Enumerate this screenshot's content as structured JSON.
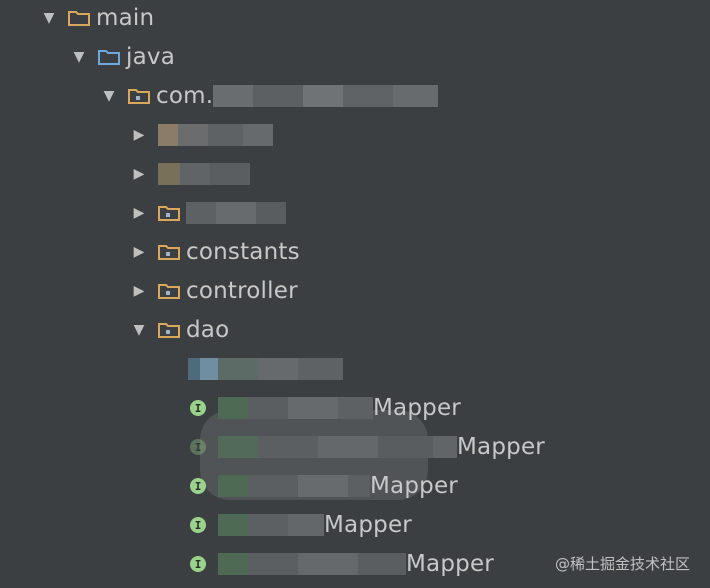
{
  "colors": {
    "background": "#3c3f41",
    "folder_brown": "#d9a85c",
    "folder_blue": "#6fa8dc",
    "interface_badge": "#9ad28c",
    "text": "#c8c8c8"
  },
  "tree": {
    "main": {
      "label": "main",
      "icon": "folder-icon"
    },
    "java": {
      "label": "java",
      "icon": "source-folder-icon"
    },
    "package": {
      "label_prefix": "com."
    },
    "folders": [
      {
        "label": ""
      },
      {
        "label": ""
      },
      {
        "label": ""
      },
      {
        "label": "constants"
      },
      {
        "label": "controller"
      },
      {
        "label": "dao"
      }
    ],
    "dao_children": [
      {
        "label": ""
      },
      {
        "badge": "I",
        "suffix": "Mapper"
      },
      {
        "badge": "I",
        "suffix": "Mapper"
      },
      {
        "badge": "I",
        "suffix": "Mapper"
      },
      {
        "badge": "I",
        "suffix": "Mapper"
      },
      {
        "badge": "I",
        "suffix": "Mapper"
      }
    ]
  },
  "watermark": "@稀土掘金技术社区"
}
